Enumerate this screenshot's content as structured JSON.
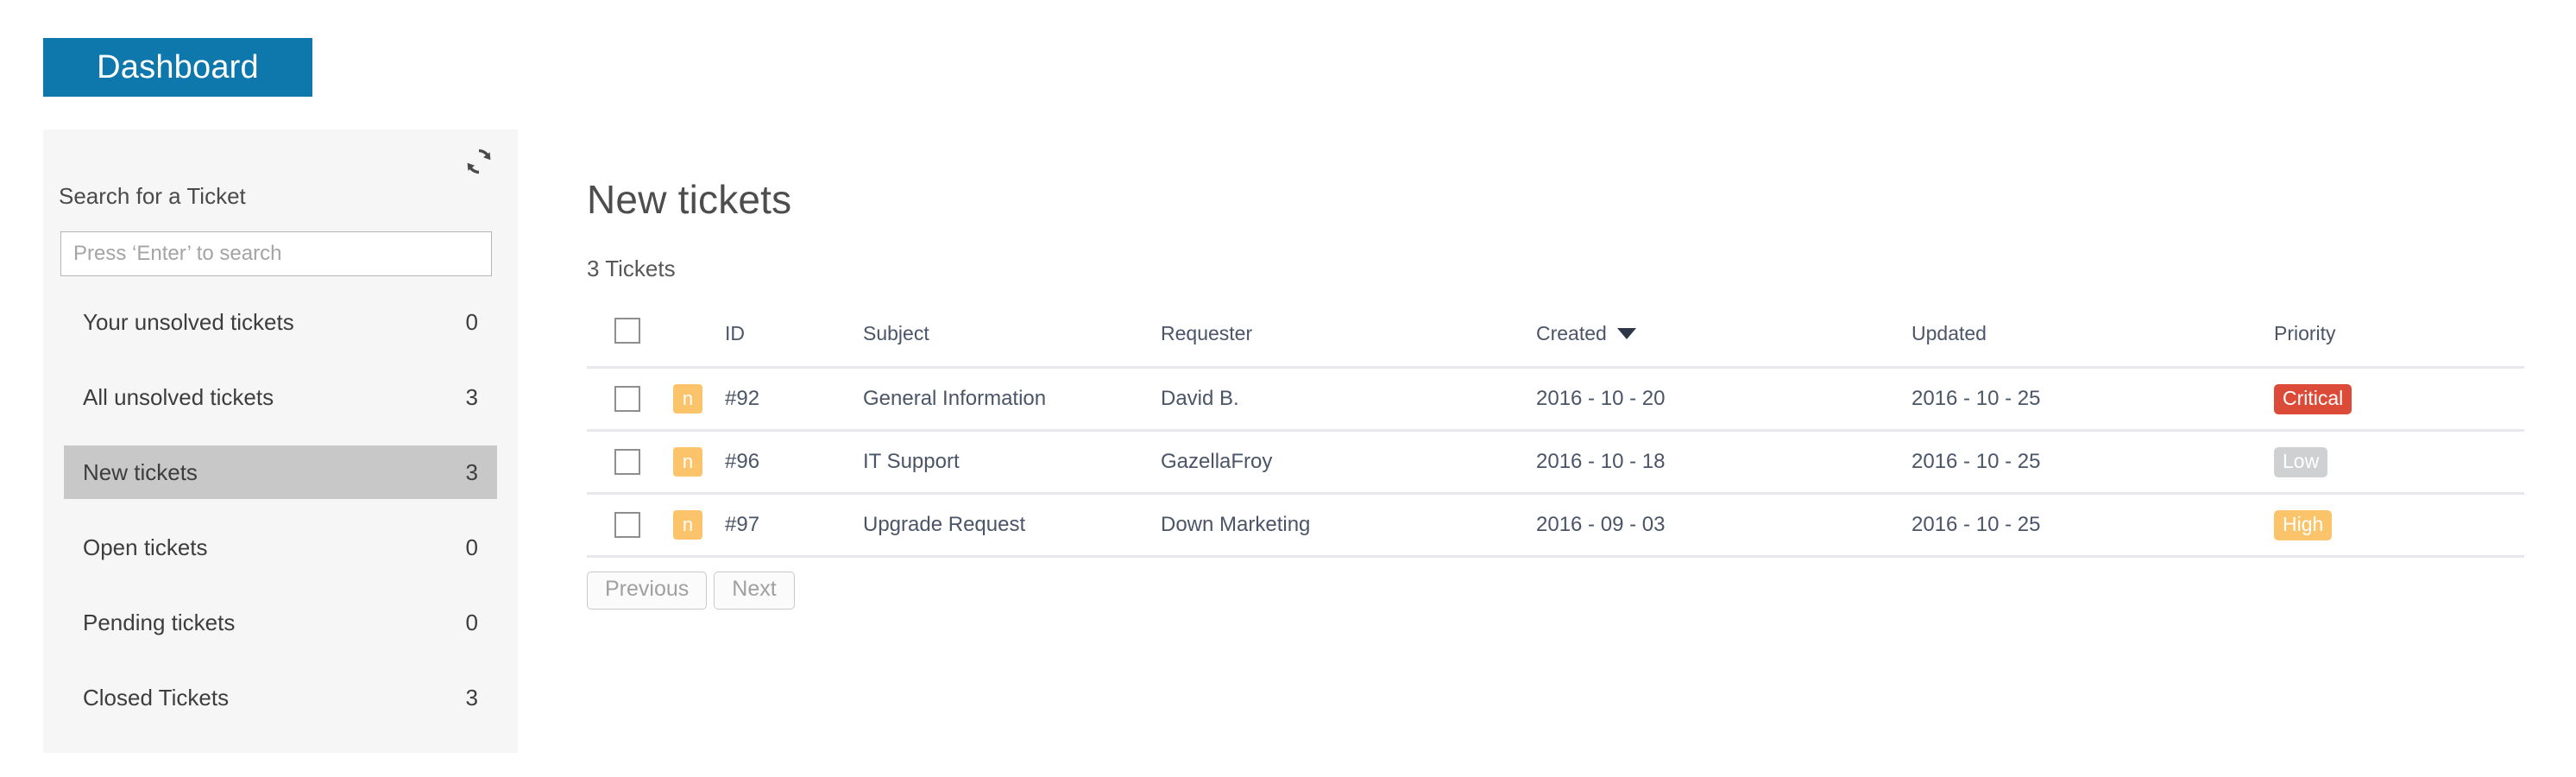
{
  "tab": {
    "label": "Dashboard"
  },
  "sidebar": {
    "refresh_icon": "refresh-icon",
    "search_label": "Search for a Ticket",
    "search": {
      "value": "",
      "placeholder": "Press ‘Enter’ to search"
    },
    "items": [
      {
        "label": "Your unsolved tickets",
        "count": "0",
        "selected": false
      },
      {
        "label": "All unsolved tickets",
        "count": "3",
        "selected": false
      },
      {
        "label": "New tickets",
        "count": "3",
        "selected": true
      },
      {
        "label": "Open tickets",
        "count": "0",
        "selected": false
      },
      {
        "label": "Pending tickets",
        "count": "0",
        "selected": false
      },
      {
        "label": "Closed Tickets",
        "count": "3",
        "selected": false
      }
    ]
  },
  "main": {
    "title": "New tickets",
    "count_label": "3 Tickets",
    "table": {
      "columns": [
        {
          "key": "select",
          "label": ""
        },
        {
          "key": "type",
          "label": ""
        },
        {
          "key": "id",
          "label": "ID"
        },
        {
          "key": "subject",
          "label": "Subject"
        },
        {
          "key": "requester",
          "label": "Requester"
        },
        {
          "key": "created",
          "label": "Created",
          "sorted": "desc"
        },
        {
          "key": "updated",
          "label": "Updated"
        },
        {
          "key": "priority",
          "label": "Priority"
        }
      ],
      "rows": [
        {
          "type_badge": "n",
          "id": "#92",
          "subject": "General Information",
          "requester": "David B.",
          "created": "2016 - 10 - 20",
          "updated": "2016 - 10 - 25",
          "priority": "Critical",
          "priority_class": "prio-critical"
        },
        {
          "type_badge": "n",
          "id": "#96",
          "subject": "IT Support",
          "requester": "GazellaFroy",
          "created": "2016 - 10 - 18",
          "updated": "2016 - 10 - 25",
          "priority": "Low",
          "priority_class": "prio-low"
        },
        {
          "type_badge": "n",
          "id": "#97",
          "subject": "Upgrade Request",
          "requester": "Down Marketing",
          "created": "2016 - 09 - 03",
          "updated": "2016 - 10 - 25",
          "priority": "High",
          "priority_class": "prio-high"
        }
      ]
    },
    "pagination": {
      "previous_label": "Previous",
      "next_label": "Next"
    }
  },
  "colors": {
    "tab_blue": "#0e77ac",
    "sidebar_bg": "#f6f6f6",
    "selected_item": "#c8c8c8",
    "badge_orange": "#fbc46a",
    "priority_critical": "#dc4b38",
    "priority_low": "#cfd0d2",
    "priority_high": "#fbc46a",
    "table_text": "#4a5568",
    "row_divider": "#e6e8eb"
  }
}
